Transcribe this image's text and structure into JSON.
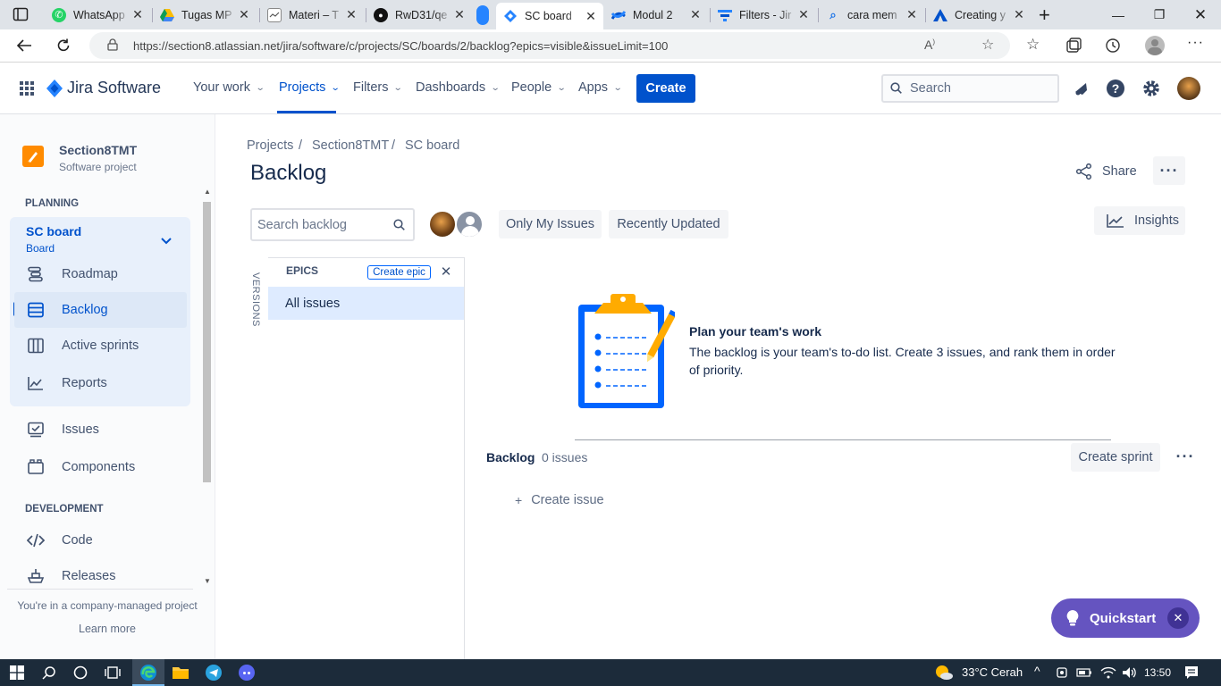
{
  "browser": {
    "tabs": [
      {
        "label": "WhatsApp",
        "icon": "whatsapp-icon",
        "color": "#25d366"
      },
      {
        "label": "Tugas MP",
        "icon": "google-drive-icon",
        "color": "#fbbc04"
      },
      {
        "label": "Materi – T",
        "icon": "document-icon",
        "color": "#888888"
      },
      {
        "label": "RwD31/qe",
        "icon": "github-icon",
        "color": "#000000"
      },
      {
        "label": "",
        "icon": "pinned-tab-icon",
        "color": "#2684ff"
      },
      {
        "label": "SC board",
        "icon": "jira-icon",
        "color": "#0052cc"
      },
      {
        "label": "Modul 2",
        "icon": "confluence-icon",
        "color": "#0052cc"
      },
      {
        "label": "Filters - Jir",
        "icon": "jira-filters-icon",
        "color": "#2684ff"
      },
      {
        "label": "cara mem",
        "icon": "search-icon",
        "color": "#1a73e8"
      },
      {
        "label": "Creating y",
        "icon": "atlassian-icon",
        "color": "#0052cc"
      }
    ],
    "url": "https://section8.atlassian.net/jira/software/c/projects/SC/boards/2/backlog?epics=visible&issueLimit=100"
  },
  "jira_nav": {
    "product": "Jira Software",
    "items": [
      {
        "label": "Your work"
      },
      {
        "label": "Projects"
      },
      {
        "label": "Filters"
      },
      {
        "label": "Dashboards"
      },
      {
        "label": "People"
      },
      {
        "label": "Apps"
      }
    ],
    "create_label": "Create",
    "search_placeholder": "Search"
  },
  "sidebar": {
    "project_name": "Section8TMT",
    "project_type": "Software project",
    "planning_heading": "PLANNING",
    "board_name": "SC board",
    "board_sub": "Board",
    "planning_items": [
      {
        "label": "Roadmap",
        "icon": "roadmap-icon"
      },
      {
        "label": "Backlog",
        "icon": "backlog-icon"
      },
      {
        "label": "Active sprints",
        "icon": "board-columns-icon"
      },
      {
        "label": "Reports",
        "icon": "reports-chart-icon"
      }
    ],
    "other_items": [
      {
        "label": "Issues",
        "icon": "issues-icon"
      },
      {
        "label": "Components",
        "icon": "components-icon"
      }
    ],
    "development_heading": "DEVELOPMENT",
    "development_items": [
      {
        "label": "Code",
        "icon": "code-icon"
      },
      {
        "label": "Releases",
        "icon": "releases-icon"
      }
    ],
    "footer_text": "You're in a company-managed project",
    "learn_more": "Learn more"
  },
  "main": {
    "breadcrumbs": [
      "Projects",
      "Section8TMT",
      "SC board"
    ],
    "title": "Backlog",
    "share_label": "Share",
    "insights_label": "Insights",
    "search_placeholder": "Search backlog",
    "filters": [
      "Only My Issues",
      "Recently Updated"
    ],
    "versions_label": "VERSIONS",
    "epics_title": "EPICS",
    "create_epic": "Create epic",
    "all_issues": "All issues",
    "empty_title": "Plan your team's work",
    "empty_desc": "The backlog is your team's to-do list. Create 3 issues, and rank them in order of priority.",
    "backlog_label": "Backlog",
    "backlog_count": "0 issues",
    "create_sprint": "Create sprint",
    "create_issue": "Create issue",
    "quickstart": "Quickstart"
  },
  "taskbar": {
    "weather": "33°C  Cerah",
    "time": "13:50"
  },
  "colors": {
    "accent": "#0052cc",
    "quickstart": "#6554c0",
    "taskbar": "#1c2b3a"
  }
}
